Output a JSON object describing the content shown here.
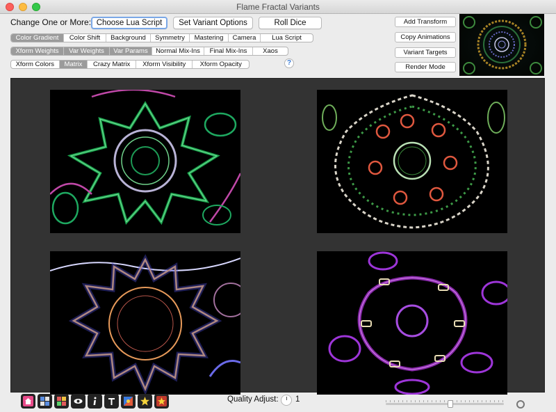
{
  "window": {
    "title": "Flame Fractal Variants"
  },
  "change_label": "Change One or More:",
  "primary_buttons": [
    {
      "id": "lua",
      "label": "Choose Lua Script",
      "focused": true
    },
    {
      "id": "options",
      "label": "Set Variant Options",
      "focused": false
    },
    {
      "id": "dice",
      "label": "Roll Dice",
      "focused": false
    }
  ],
  "segment_rows": [
    {
      "items": [
        "Color Gradient",
        "Color Shift",
        "Background",
        "Symmetry",
        "Mastering",
        "Camera",
        "Lua Script"
      ],
      "selected": [
        0
      ]
    },
    {
      "items": [
        "Xform Weights",
        "Var Weights",
        "Var Params",
        "Normal Mix-Ins",
        "Final Mix-Ins",
        "Xaos"
      ],
      "selected": [
        0,
        1,
        2
      ]
    },
    {
      "items": [
        "Xform Colors",
        "Matrix",
        "Crazy Matrix",
        "Xform Visibility",
        "Xform Opacity"
      ],
      "selected": [
        1
      ]
    }
  ],
  "help_label": "?",
  "right_buttons": [
    "Add Transform",
    "Copy Animations",
    "Variant Targets",
    "Render Mode"
  ],
  "quality": {
    "label": "Quality Adjust:",
    "value": "1"
  },
  "slider": {
    "level": 0.55
  },
  "tools": [
    "home-icon",
    "grid-icon",
    "grid-color-icon",
    "eye-icon",
    "info-icon",
    "text-icon",
    "palette-icon",
    "star-icon",
    "star-badge-icon"
  ],
  "colors": {
    "selected_segment": "#9b9b9b",
    "canvas_background": "#333333",
    "focus_ring": "#7aa7e6"
  }
}
